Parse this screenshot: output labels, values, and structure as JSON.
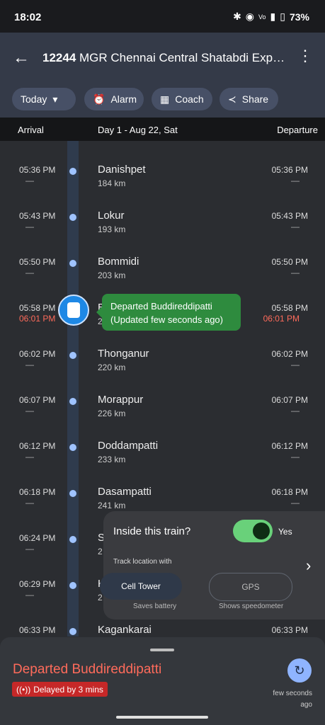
{
  "status_bar": {
    "time": "18:02",
    "battery": "73%",
    "icons": [
      "bluetooth-icon",
      "location-icon",
      "volte-icon",
      "5g-icon",
      "signal-icon",
      "battery-icon"
    ]
  },
  "app_bar": {
    "train_number": "12244",
    "train_name": "MGR Chennai Central Shatabdi Express..."
  },
  "chips": {
    "date": "Today",
    "alarm": "Alarm",
    "coach": "Coach",
    "share": "Share"
  },
  "list_header": {
    "arrival": "Arrival",
    "day": "Day 1 - Aug 22, Sat",
    "departure": "Departure"
  },
  "stations": [
    {
      "arr": "05:36 PM",
      "arr_delay": "—",
      "dep": "05:36 PM",
      "dep_delay": "—",
      "name": "Danishpet",
      "km": "184 km"
    },
    {
      "arr": "05:43 PM",
      "arr_delay": "—",
      "dep": "05:43 PM",
      "dep_delay": "—",
      "name": "Lokur",
      "km": "193 km"
    },
    {
      "arr": "05:50 PM",
      "arr_delay": "—",
      "dep": "05:50 PM",
      "dep_delay": "—",
      "name": "Bommidi",
      "km": "203 km"
    },
    {
      "arr": "05:58 PM",
      "arr_delay": "06:01 PM",
      "dep": "05:58 PM",
      "dep_delay": "06:01 PM",
      "name": "B",
      "km": "2"
    },
    {
      "arr": "06:02 PM",
      "arr_delay": "—",
      "dep": "06:02 PM",
      "dep_delay": "—",
      "name": "Thonganur",
      "km": "220 km"
    },
    {
      "arr": "06:07 PM",
      "arr_delay": "—",
      "dep": "06:07 PM",
      "dep_delay": "—",
      "name": "Morappur",
      "km": "226 km"
    },
    {
      "arr": "06:12 PM",
      "arr_delay": "—",
      "dep": "06:12 PM",
      "dep_delay": "—",
      "name": "Doddampatti",
      "km": "233 km"
    },
    {
      "arr": "06:18 PM",
      "arr_delay": "—",
      "dep": "06:18 PM",
      "dep_delay": "—",
      "name": "Dasampatti",
      "km": "241 km"
    },
    {
      "arr": "06:24 PM",
      "arr_delay": "—",
      "dep": "",
      "dep_delay": "",
      "name": "S",
      "km": "2"
    },
    {
      "arr": "06:29 PM",
      "arr_delay": "—",
      "dep": "",
      "dep_delay": "",
      "name": "K",
      "km": "2"
    },
    {
      "arr": "06:33 PM",
      "arr_delay": "",
      "dep": "06:33 PM",
      "dep_delay": "",
      "name": "Kagankarai",
      "km": ""
    }
  ],
  "current_bubble": {
    "line1": "Departed Buddireddipatti",
    "line2": "(Updated few seconds ago)"
  },
  "inside_card": {
    "question": "Inside this train?",
    "toggle_label": "Yes",
    "track_label": "Track location with",
    "option1": "Cell Tower",
    "option1_sub": "Saves battery",
    "option2": "GPS",
    "option2_sub": "Shows speedometer"
  },
  "bottom_sheet": {
    "status": "Departed Buddireddipatti",
    "delay_badge": "Delayed by 3 mins",
    "updated_line1": "few seconds",
    "updated_line2": "ago"
  }
}
